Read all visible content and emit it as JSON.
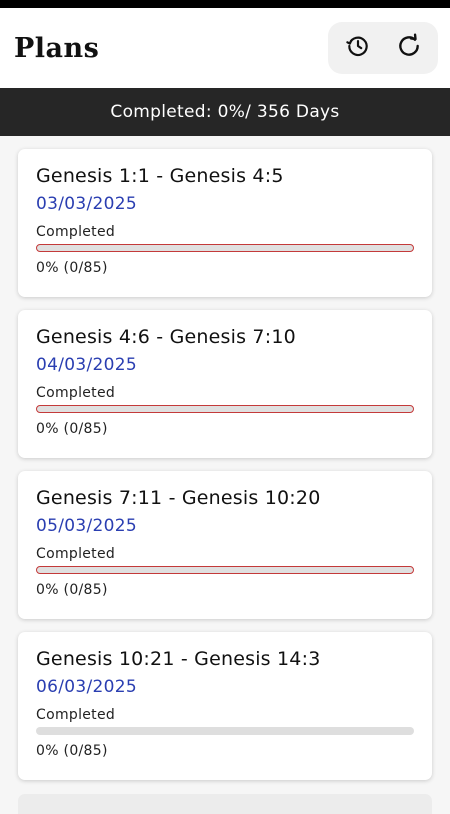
{
  "header": {
    "title": "Plans",
    "actions": [
      {
        "icon": "history-icon"
      },
      {
        "icon": "reset-icon"
      }
    ]
  },
  "summary": {
    "text": "Completed: 0%/ 356 Days"
  },
  "colors": {
    "date": "#2a3eb1",
    "progress_accent": "#c43a3a",
    "summary_bg": "#262626"
  },
  "plans": [
    {
      "range": "Genesis 1:1 - Genesis 4:5",
      "date": "03/03/2025",
      "status": "Completed",
      "count": "0% (0/85)",
      "progress": 0
    },
    {
      "range": "Genesis 4:6 - Genesis 7:10",
      "date": "04/03/2025",
      "status": "Completed",
      "count": "0% (0/85)",
      "progress": 0
    },
    {
      "range": "Genesis 7:11 - Genesis 10:20",
      "date": "05/03/2025",
      "status": "Completed",
      "count": "0% (0/85)",
      "progress": 0
    },
    {
      "range": "Genesis 10:21 - Genesis 14:3",
      "date": "06/03/2025",
      "status": "Completed",
      "count": "0% (0/85)",
      "progress": 0
    }
  ]
}
